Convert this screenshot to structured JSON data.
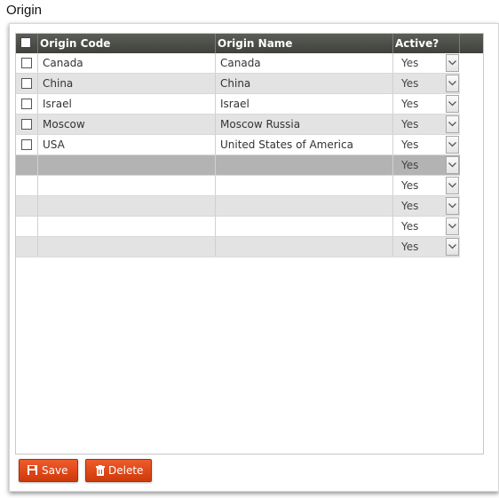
{
  "page": {
    "title": "Origin"
  },
  "grid": {
    "columns": [
      "Origin Code",
      "Origin Name",
      "Active?"
    ],
    "rows": [
      {
        "code": "Canada",
        "name": "Canada",
        "active": "Yes"
      },
      {
        "code": "China",
        "name": "China",
        "active": "Yes"
      },
      {
        "code": "Israel",
        "name": "Israel",
        "active": "Yes"
      },
      {
        "code": "Moscow",
        "name": "Moscow Russia",
        "active": "Yes"
      },
      {
        "code": "USA",
        "name": "United States of America",
        "active": "Yes"
      },
      {
        "code": "",
        "name": "",
        "active": "Yes"
      },
      {
        "code": "",
        "name": "",
        "active": "Yes"
      },
      {
        "code": "",
        "name": "",
        "active": "Yes"
      },
      {
        "code": "",
        "name": "",
        "active": "Yes"
      },
      {
        "code": "",
        "name": "",
        "active": "Yes"
      }
    ]
  },
  "toolbar": {
    "save_label": "Save",
    "delete_label": "Delete"
  },
  "icons": {
    "save": "floppy-disk-icon",
    "delete": "trash-icon",
    "dropdown": "chevron-down-icon"
  },
  "colors": {
    "header_bg": "#4a4c47",
    "button_bg": "#e0491a",
    "selected_row": "#b3b3b3",
    "alt_row": "#e3e3e3"
  }
}
